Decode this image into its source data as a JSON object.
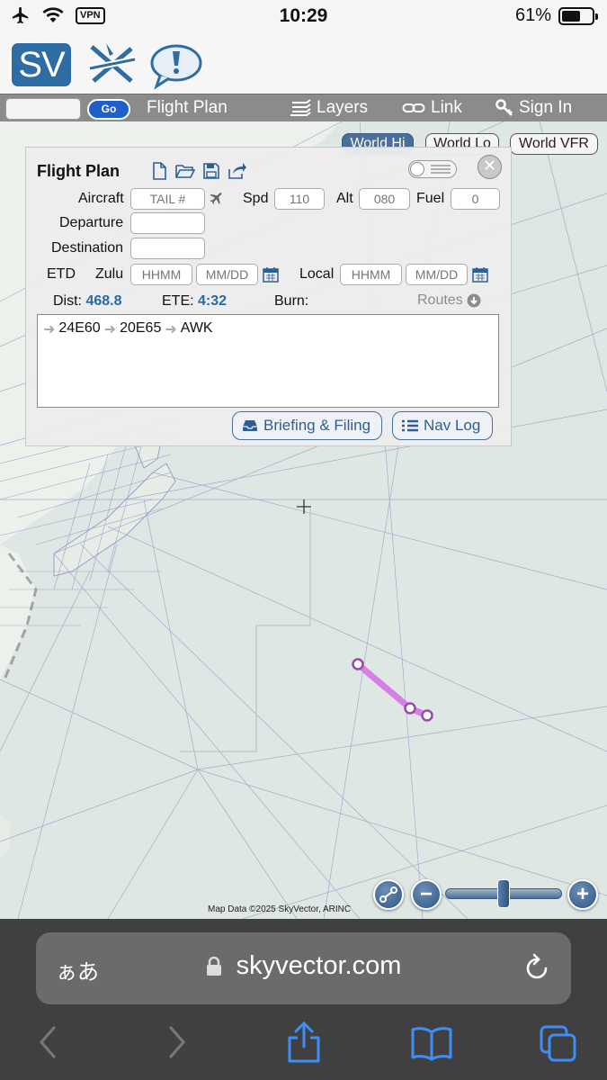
{
  "status_bar": {
    "time": "10:29",
    "vpn_label": "VPN",
    "battery_percent_text": "61%",
    "battery_level": 0.61
  },
  "app": {
    "logo_text": "SV"
  },
  "toolbar": {
    "search_value": "",
    "go_label": "Go",
    "flight_plan_label": "Flight Plan",
    "layers_label": "Layers",
    "link_label": "Link",
    "sign_in_label": "Sign In"
  },
  "map": {
    "chart_buttons": [
      {
        "label": "World Hi",
        "active": true
      },
      {
        "label": "World Lo",
        "active": false
      },
      {
        "label": "World VFR",
        "active": false
      }
    ],
    "copyright": "Map Data ©2025 SkyVector, ARINC",
    "zoom_level": 0.5,
    "route_color": "#d680e6"
  },
  "flight_plan": {
    "title": "Flight Plan",
    "aircraft_label": "Aircraft",
    "aircraft_placeholder": "TAIL #",
    "spd_label": "Spd",
    "spd_placeholder": "110",
    "alt_label": "Alt",
    "alt_placeholder": "080",
    "fuel_label": "Fuel",
    "fuel_placeholder": "0",
    "departure_label": "Departure",
    "departure_value": "",
    "destination_label": "Destination",
    "destination_value": "",
    "etd_label": "ETD",
    "zulu_label": "Zulu",
    "zulu_time_placeholder": "HHMM",
    "zulu_date_placeholder": "MM/DD",
    "local_label": "Local",
    "local_time_placeholder": "HHMM",
    "local_date_placeholder": "MM/DD",
    "dist_label": "Dist:",
    "dist_value": "468.8",
    "ete_label": "ETE:",
    "ete_value": "4:32",
    "burn_label": "Burn:",
    "routes_label": "Routes",
    "route_waypoints": [
      "24E60",
      "20E65",
      "AWK"
    ],
    "briefing_label": "Briefing & Filing",
    "navlog_label": "Nav Log"
  },
  "browser": {
    "aa_label": "ぁあ",
    "url": "skyvector.com"
  }
}
